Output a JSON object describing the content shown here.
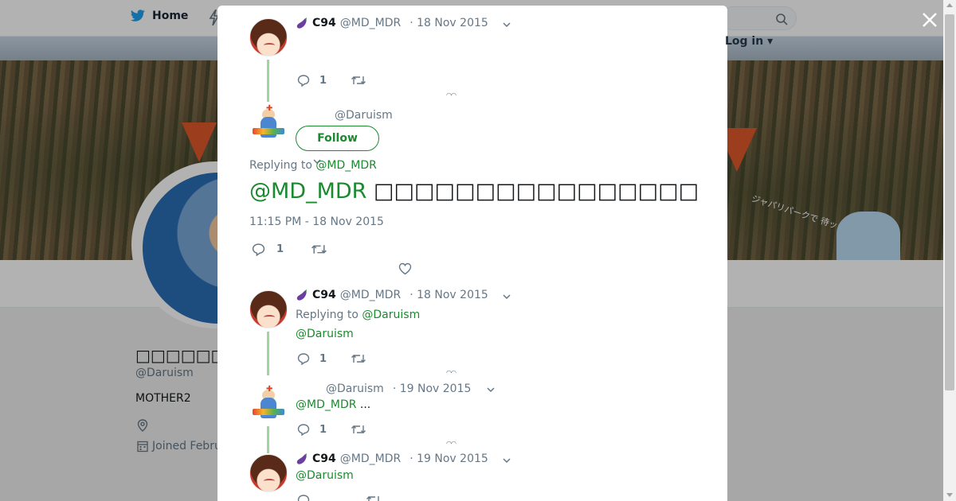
{
  "background": {
    "nav": {
      "home_label": "Home",
      "login_label": "Log in"
    },
    "banner": {
      "caption": "ジャパリパークで 待ッテルヨ!"
    },
    "profile": {
      "name": "□□□□□□□□□□",
      "handle": "@Daruism",
      "bio": "MOTHER2",
      "joined": "Joined Febru"
    }
  },
  "modal": {
    "tweets": [
      {
        "display_name": "C94",
        "handle": "@MD_MDR",
        "date": "· 18 Nov 2015",
        "reply_count": "1",
        "loader": "◠◠"
      },
      {
        "handle": "@Daruism",
        "follow_label": "Follow",
        "replying_prefix": "Replying to",
        "replying_to": "@MD_MDR",
        "text_mention": "@MD_MDR",
        "text_body": "□□□□□□□□□□□□□□□□",
        "timestamp": "11:15 PM - 18 Nov 2015",
        "reply_count": "1"
      },
      {
        "display_name": "C94",
        "handle": "@MD_MDR",
        "date": "· 18 Nov 2015",
        "replying_prefix": "Replying to",
        "replying_to": "@Daruism",
        "text_mention": "@Daruism",
        "reply_count": "1",
        "loader": "◠◠"
      },
      {
        "handle": "@Daruism",
        "date": "· 19 Nov 2015",
        "text_mention": "@MD_MDR",
        "text_body": " ...",
        "reply_count": "1",
        "loader": "◠◠"
      },
      {
        "display_name": "C94",
        "handle": "@MD_MDR",
        "date": "· 19 Nov 2015",
        "text_mention": "@Daruism"
      }
    ]
  },
  "colors": {
    "accent_green": "#1b8a2f",
    "thread_line": "#9fd69b",
    "muted_text": "#657786",
    "twitter_blue": "#1da1f2",
    "eggplant": "#6b3fa0"
  },
  "icons": [
    "twitter-bird-icon",
    "close-icon",
    "search-icon",
    "reply-icon",
    "retweet-icon",
    "like-icon",
    "chevron-down-icon",
    "eggplant-icon",
    "location-icon",
    "calendar-icon"
  ]
}
